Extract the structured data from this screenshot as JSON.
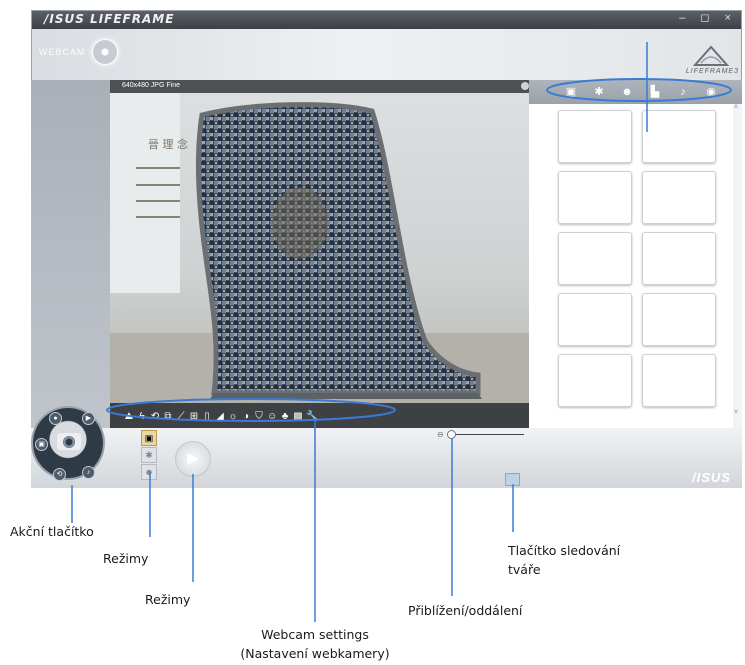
{
  "window": {
    "brand": "/ISUS LIFEFRAME",
    "controls": "– ◻ ×",
    "webcam_label": "WEBCAM",
    "lifeframe_logo_text": "LIFEFRAME3",
    "preview_info": "640x480 JPG Fine",
    "asus_logo": "/ISUS"
  },
  "tabs": [
    {
      "icon": "camera-icon",
      "glyph": "▣"
    },
    {
      "icon": "settings-icon",
      "glyph": "✱"
    },
    {
      "icon": "face-icon",
      "glyph": "☻"
    },
    {
      "icon": "video-icon",
      "glyph": "▙"
    },
    {
      "icon": "microphone-icon",
      "glyph": "♪"
    },
    {
      "icon": "eye-icon",
      "glyph": "◉"
    }
  ],
  "toolbar_icons": [
    {
      "name": "scene-icon",
      "glyph": "⛰"
    },
    {
      "name": "flash-icon",
      "glyph": "ϟ"
    },
    {
      "name": "timer-icon",
      "glyph": "⟲"
    },
    {
      "name": "burst-icon",
      "glyph": "⧉"
    },
    {
      "name": "measure-icon",
      "glyph": "⟋"
    },
    {
      "name": "exposure-icon",
      "glyph": "⊞"
    },
    {
      "name": "frame-icon",
      "glyph": "▯"
    },
    {
      "name": "contrast-icon",
      "glyph": "◢"
    },
    {
      "name": "brightness-icon",
      "glyph": "☼"
    },
    {
      "name": "saturation-icon",
      "glyph": "◑"
    },
    {
      "name": "white-balance-icon",
      "glyph": "⛉"
    },
    {
      "name": "face-effect-icon",
      "glyph": "☺"
    },
    {
      "name": "color-effect-icon",
      "glyph": "♣"
    },
    {
      "name": "image-effect-icon",
      "glyph": "▩"
    },
    {
      "name": "wrench-icon",
      "glyph": "🔧"
    }
  ],
  "mode_glyphs": [
    "▣",
    "✱",
    "☻"
  ],
  "play_glyph": "▶",
  "zoom_glyph": "⊖",
  "scroll": {
    "up": "˄",
    "down": "˅"
  },
  "callouts": {
    "action_button": "Akční tlačítko",
    "modes_1": "Režimy",
    "modes_2": "Režimy",
    "face_tracking_line1": "Tlačítko sledování",
    "face_tracking_line2": "tváře",
    "zoom": "Přiblížení/oddálení",
    "webcam_settings_line1": "Webcam settings",
    "webcam_settings_line2": "(Nastavení webkamery)"
  },
  "colors": {
    "callout_line": "#3a7bd5",
    "highlight_ring": "#3a7bd5"
  }
}
